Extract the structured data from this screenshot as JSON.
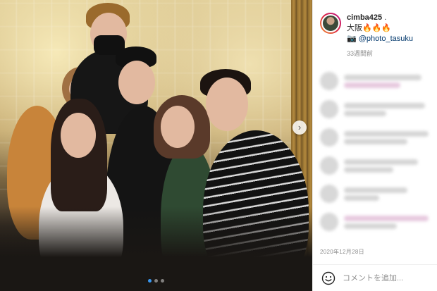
{
  "post": {
    "image_alt": "",
    "carousel": {
      "total": 3,
      "active_index": 0
    }
  },
  "header": {
    "username": "cimba425",
    "username_suffix": ".",
    "caption_line1": "大阪🔥🔥🔥",
    "caption_line2_prefix": "📷 ",
    "mention": "@photo_tasuku",
    "time_ago": "33週間前"
  },
  "post_date": "2020年12月28日",
  "comment_box": {
    "placeholder": "コメントを追加..."
  },
  "colors": {
    "accent": "#3897f0",
    "mention": "#00376b",
    "muted": "#8e8e8e"
  },
  "icons": {
    "next": "chevron-right-icon",
    "emoji": "smiley-icon"
  }
}
